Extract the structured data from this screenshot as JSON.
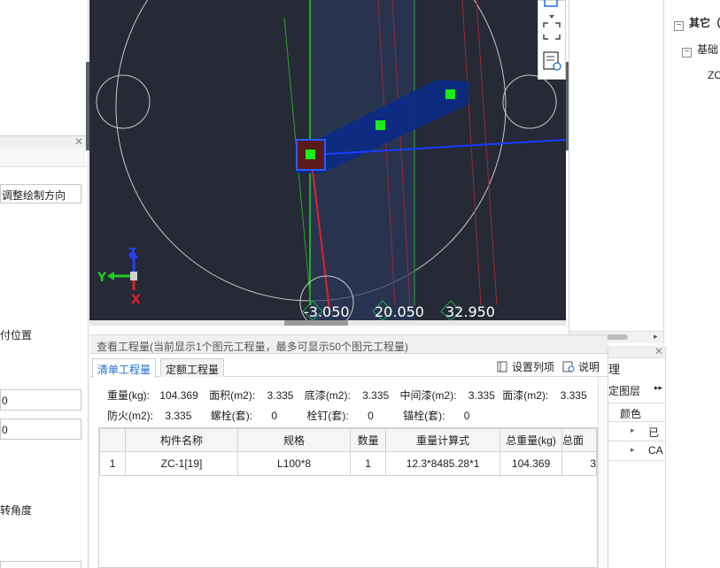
{
  "left_panel": {
    "direction_value": "调整绘制方向",
    "position_label": "付位置",
    "field1_value": "0",
    "field2_value": "0",
    "angle_label": "转角度"
  },
  "viewport": {
    "elevations": [
      "-3.050",
      "20.050",
      "32.950"
    ],
    "axes": {
      "y": "Y",
      "z": "Z",
      "x": "X"
    }
  },
  "right_panel": {
    "tree": [
      {
        "label": "其它（",
        "level": 0
      },
      {
        "label": "基础",
        "level": 1
      },
      {
        "label": "ZC",
        "level": 2
      }
    ]
  },
  "bottom_right_panel": {
    "title_fragment": "理",
    "layer_label": "定图层",
    "color_header": "颜色",
    "rows": [
      "已",
      "CA"
    ]
  },
  "quantity": {
    "title": "查看工程量(当前显示1个图元工程量，最多可显示50个图元工程量)",
    "tabs": [
      "清单工程量",
      "定额工程量"
    ],
    "toolbar": {
      "set_columns": "设置列项",
      "help": "说明"
    },
    "summary_row1": [
      {
        "label": "重量(kg):",
        "value": "104.369"
      },
      {
        "label": "面积(m2):",
        "value": "3.335"
      },
      {
        "label": "底漆(m2):",
        "value": "3.335"
      },
      {
        "label": "中间漆(m2):",
        "value": "3.335"
      },
      {
        "label": "面漆(m2):",
        "value": "3.335"
      }
    ],
    "summary_row2": [
      {
        "label": "防火(m2):",
        "value": "3.335"
      },
      {
        "label": "螺栓(套):",
        "value": "0"
      },
      {
        "label": "栓钉(套):",
        "value": "0"
      },
      {
        "label": "锚栓(套):",
        "value": "0"
      }
    ],
    "columns": [
      "",
      "构件名称",
      "规格",
      "数量",
      "重量计算式",
      "总重量(kg)",
      "总面"
    ],
    "rows": [
      [
        "1",
        "ZC-1[19]",
        "L100*8",
        "1",
        "12.3*8485.28*1",
        "104.369",
        "3"
      ]
    ]
  },
  "colors": {
    "viewport_bg": "#252a36",
    "member_blue": "#0a2a86",
    "node_green": "#1aee1a",
    "active_tab": "#1a6fd2"
  }
}
